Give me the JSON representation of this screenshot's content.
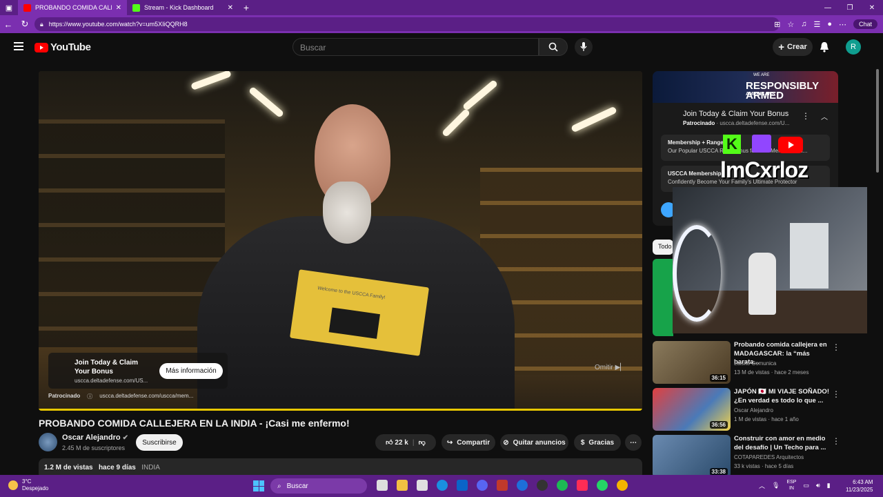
{
  "browser": {
    "tabs": [
      {
        "title": "PROBANDO COMIDA CALLE",
        "active": true
      },
      {
        "title": "Stream - Kick Dashboard",
        "active": false
      }
    ],
    "url": "https://www.youtube.com/watch?v=um5XIiQQRH8",
    "chat_label": "Chat"
  },
  "yt_header": {
    "logo": "YouTube",
    "search_placeholder": "Buscar",
    "create_label": "Crear",
    "avatar_letter": "R"
  },
  "player": {
    "ad_title": "Join Today & Claim Your Bonus",
    "ad_domain": "uscca.deltadefense.com/US...",
    "ad_button": "Más información",
    "skip_label": "Omitir",
    "sponsored_label": "Patrocinado",
    "sponsored_url": "uscca.deltadefense.com/uscca/mem...",
    "card_text": "Welcome to the USCCA Family!"
  },
  "video": {
    "title": "PROBANDO COMIDA CALLEJERA EN LA INDIA - ¡Casi me enfermo!",
    "channel": "Oscar Alejandro",
    "subscribers": "2.45 M de suscriptores",
    "subscribe_label": "Suscribirse",
    "likes": "22 k",
    "share_label": "Compartir",
    "remove_ads_label": "Quitar anuncios",
    "thanks_label": "Gracias",
    "views": "1.2 M de vistas",
    "age": "hace 9 días",
    "tag": "INDIA"
  },
  "side_ad": {
    "banner_top": "WE ARE",
    "banner_main": "RESPONSIBLY ARMED",
    "banner_sub": "AMERICANS",
    "title": "Join Today & Claim Your Bonus",
    "sponsored": "Patrocinado",
    "domain": "uscca.deltadefense.com/U...",
    "link1_title": "Membership + Range B...",
    "link1_desc": "Our Popular USCCA Ra... Bonus for New Members - Li...",
    "link2_title": "USCCA Membership",
    "link2_desc": "Confidently Become Your Family's Ultimate Protector"
  },
  "stream_overlay": {
    "kick_letter": "K",
    "streamer_name": "lmCxrloz"
  },
  "filter_chip": "Todo",
  "recommendations": [
    {
      "title": "Probando comida callejera en MADAGASCAR: la “más barata...",
      "channel": "Luisito Comunica",
      "meta": "13 M de vistas · hace 2 meses",
      "duration": "36:15",
      "color": "#6a5a3c"
    },
    {
      "title": "JAPÓN 🇯🇵 MI VIAJE SOÑADO! ¿En verdad es todo lo que ...",
      "channel": "Oscar Alejandro",
      "meta": "1 M de vistas · hace 1 año",
      "duration": "36:56",
      "color": "#b83a3a"
    },
    {
      "title": "Construir con amor en medio del desafío | Un Techo para ...",
      "channel": "COTAPAREDES Arquitectos",
      "meta": "33 k vistas · hace 5 días",
      "duration": "33:38",
      "color": "#4a6a8a"
    }
  ],
  "taskbar": {
    "temp": "3°C",
    "weather": "Despejado",
    "search": "Buscar",
    "lang1": "ESP",
    "lang2": "IN",
    "time": "6:43 AM",
    "date": "11/23/2025"
  }
}
